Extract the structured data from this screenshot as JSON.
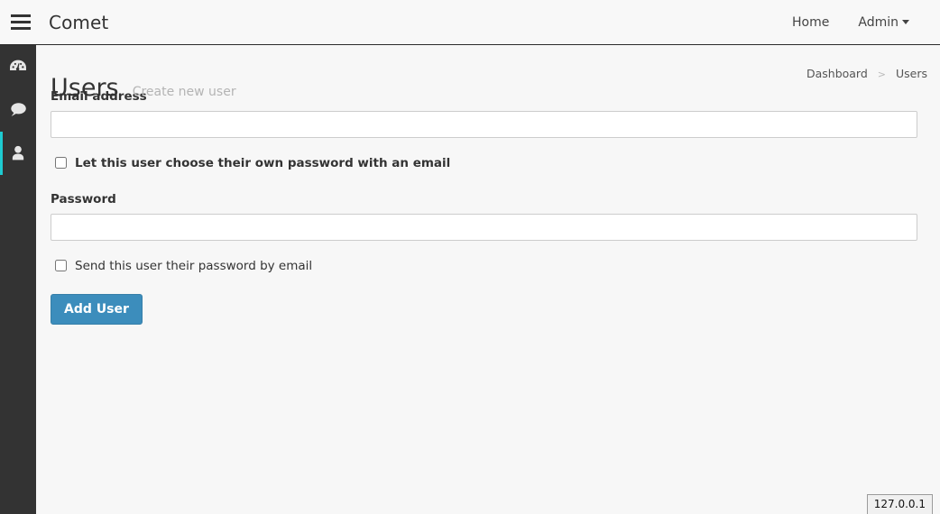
{
  "navbar": {
    "brand": "Comet",
    "menu_icon": "hamburger-icon",
    "links": [
      {
        "label": "Home"
      },
      {
        "label": "Admin",
        "has_caret": true
      }
    ]
  },
  "sidebar": {
    "items": [
      {
        "name": "dashboard",
        "icon": "gauge-icon",
        "active": false
      },
      {
        "name": "comments",
        "icon": "speech-bubble-icon",
        "active": false
      },
      {
        "name": "users",
        "icon": "user-icon",
        "active": true
      }
    ],
    "accent_color": "#1ecbd1",
    "background_color": "#333333"
  },
  "page": {
    "title": "Users",
    "subtitle": "Create new user"
  },
  "breadcrumb": {
    "items": [
      {
        "label": "Dashboard"
      },
      {
        "label": "Users"
      }
    ],
    "separator": ">"
  },
  "form": {
    "email": {
      "label": "Email address",
      "value": "",
      "placeholder": ""
    },
    "choose_password_checkbox": {
      "label": "Let this user choose their own password with an email",
      "checked": false
    },
    "password": {
      "label": "Password",
      "value": "",
      "placeholder": ""
    },
    "send_password_checkbox": {
      "label": "Send this user their password by email",
      "checked": false
    },
    "submit": {
      "label": "Add User",
      "color": "#3c8dbc"
    }
  },
  "status": {
    "text": "127.0.0.1"
  }
}
